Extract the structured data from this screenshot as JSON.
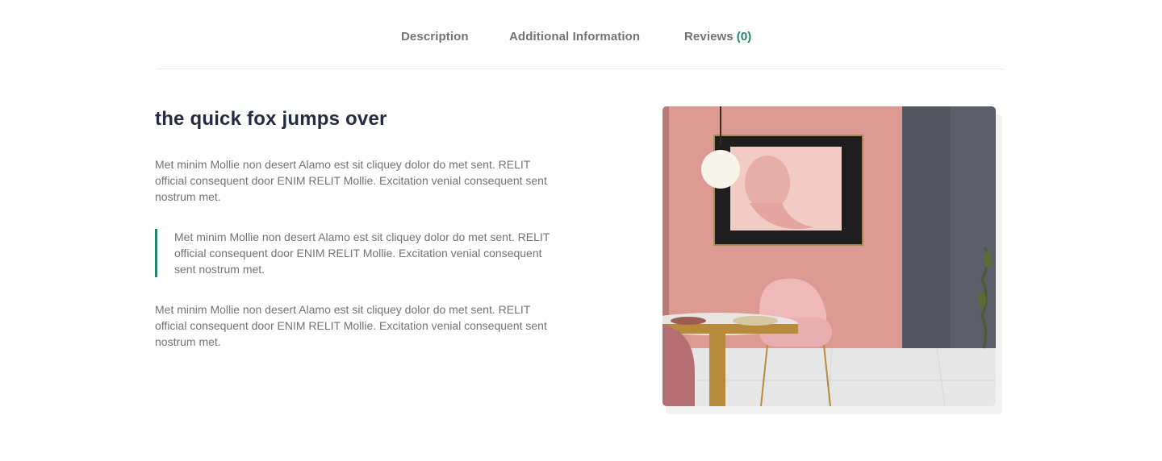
{
  "tabs": {
    "description": "Description",
    "additional_information": "Additional Information",
    "reviews": "Reviews",
    "reviews_count": "(0)"
  },
  "content": {
    "heading": "the quick fox jumps over",
    "paragraph_1": "Met minim Mollie non desert Alamo est sit cliquey dolor do met sent. RELIT official consequent door ENIM RELIT Mollie. Excitation venial consequent sent nostrum met.",
    "blockquote": "Met minim Mollie non desert Alamo est sit cliquey dolor do met sent. RELIT official consequent door ENIM RELIT Mollie. Excitation venial consequent sent nostrum met.",
    "paragraph_2": "Met minim Mollie non desert Alamo est sit cliquey dolor do met sent. RELIT official consequent door ENIM RELIT Mollie. Excitation venial consequent sent nostrum met."
  },
  "colors": {
    "accent": "#23856d",
    "heading": "#252b42",
    "text": "#737373"
  }
}
